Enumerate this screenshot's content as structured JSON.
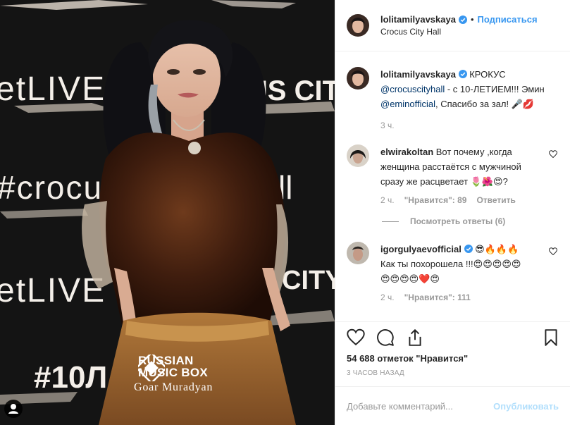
{
  "photo": {
    "backdrop_texts": [
      "etLIVE",
      "CUS CITY",
      "#crocus",
      "ll",
      "etLIVE",
      "CITY",
      "#10Л"
    ],
    "watermark_brand_line1": "RUSSIAN",
    "watermark_brand_line2": "MUSIC BOX",
    "watermark_photographer": "Goar Muradyan"
  },
  "header": {
    "username": "lolitamilyavskaya",
    "separator": "•",
    "follow_label": "Подписаться",
    "location": "Crocus City Hall"
  },
  "caption": {
    "username": "lolitamilyavskaya",
    "text_1": " КРОКУС ",
    "mention_1": "@crocuscityhall",
    "text_2": " - с 10-ЛЕТИЕМ!!! Эмин ",
    "mention_2": "@eminofficial",
    "text_3": ", Спасибо за зал! 🎤💋",
    "time": "3 ч."
  },
  "comments": [
    {
      "username": "elwirakoltan",
      "text": " Вот почему ,когда женщина расстаётся с мужчиной сразу же расцветает 🌷🌺😍?",
      "time": "2 ч.",
      "likes": "\"Нравится\": 89",
      "reply_label": "Ответить",
      "view_replies": "Посмотреть ответы (6)"
    },
    {
      "username": "igorgulyaevofficial",
      "text_suffix": " 😎🔥🔥🔥",
      "text": "Как ты похорошела !!!😍😍😍😍😍😍😍😍😍❤️😍",
      "time": "2 ч.",
      "likes": "\"Нравится\": 111"
    }
  ],
  "likes_count": "54 688 отметок \"Нравится\"",
  "posted_ago": "3 часов назад",
  "comment_box": {
    "placeholder": "Добавьте комментарий...",
    "publish_label": "Опубликовать"
  },
  "colors": {
    "link_blue": "#3897f0",
    "mention": "#003569",
    "muted": "#999999",
    "publish_disabled": "#b2dffc"
  },
  "icons": [
    "heart-icon",
    "comment-icon",
    "share-icon",
    "bookmark-icon",
    "verified-icon",
    "more-dots-icon"
  ]
}
